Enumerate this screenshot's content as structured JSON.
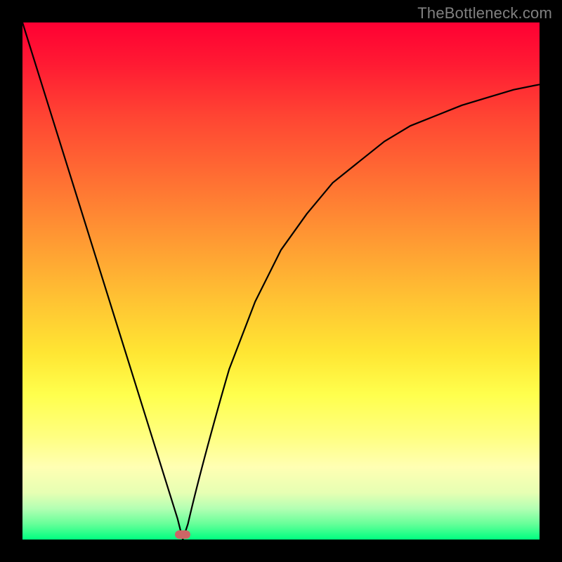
{
  "watermark": "TheBottleneck.com",
  "chart_data": {
    "type": "line",
    "title": "",
    "xlabel": "",
    "ylabel": "",
    "xlim": [
      0,
      100
    ],
    "ylim": [
      0,
      100
    ],
    "description": "V-shaped bottleneck curve on red-to-green vertical gradient. Minimum near x≈31. Left branch nearly linear from top-left to the minimum; right branch rises and flattens toward the top-right.",
    "series": [
      {
        "name": "bottleneck-curve",
        "x": [
          0,
          5,
          10,
          15,
          20,
          25,
          30,
          31,
          32,
          35,
          40,
          45,
          50,
          55,
          60,
          65,
          70,
          75,
          80,
          85,
          90,
          95,
          100
        ],
        "y": [
          100,
          84,
          68,
          52,
          36,
          20,
          4,
          0,
          3,
          16,
          33,
          46,
          56,
          63,
          69,
          73,
          77,
          80,
          82,
          84,
          85.5,
          87,
          88
        ]
      }
    ],
    "marker": {
      "x": 31,
      "y": 0,
      "color": "#cc6666"
    }
  }
}
